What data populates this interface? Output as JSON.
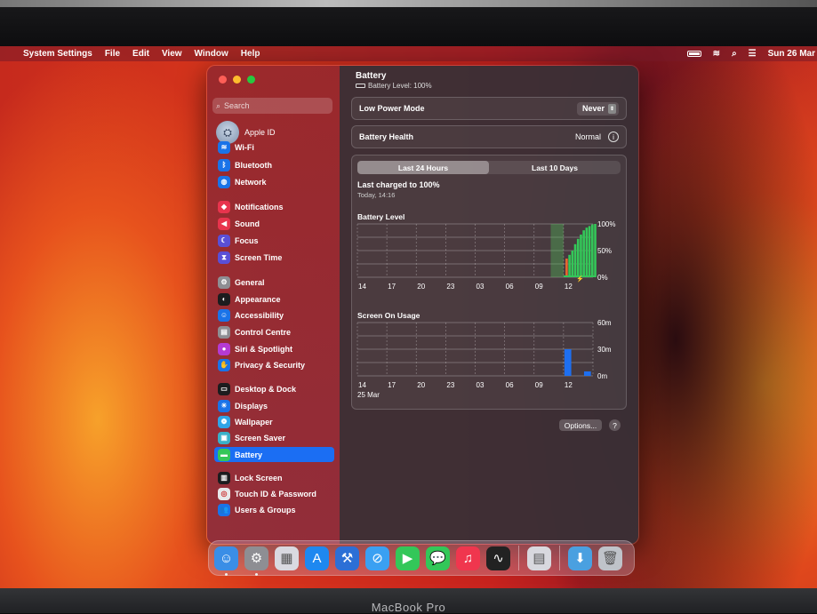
{
  "device_label": "MacBook Pro",
  "menubar": {
    "app": "System Settings",
    "items": [
      "File",
      "Edit",
      "View",
      "Window",
      "Help"
    ],
    "clock": "Sun 26 Mar"
  },
  "sidebar": {
    "search_placeholder": "Search",
    "apple_id": "Apple ID",
    "items": [
      {
        "label": "Wi-Fi",
        "icon": "wifi-icon",
        "color": "#1a73e8",
        "glyph": "≋"
      },
      {
        "label": "Bluetooth",
        "icon": "bluetooth-icon",
        "color": "#1a73e8",
        "glyph": "ᛒ"
      },
      {
        "label": "Network",
        "icon": "globe-icon",
        "color": "#1a73e8",
        "glyph": "◍"
      },
      {
        "label": "Notifications",
        "icon": "bell-icon",
        "color": "#e8344d",
        "glyph": "◆"
      },
      {
        "label": "Sound",
        "icon": "speaker-icon",
        "color": "#e8344d",
        "glyph": "◀"
      },
      {
        "label": "Focus",
        "icon": "moon-icon",
        "color": "#5a4fd6",
        "glyph": "☾"
      },
      {
        "label": "Screen Time",
        "icon": "hourglass-icon",
        "color": "#5a4fd6",
        "glyph": "⧗"
      },
      {
        "label": "General",
        "icon": "gear-icon",
        "color": "#8e8e93",
        "glyph": "⚙"
      },
      {
        "label": "Appearance",
        "icon": "appearance-icon",
        "color": "#1c1c1e",
        "glyph": "◐"
      },
      {
        "label": "Accessibility",
        "icon": "accessibility-icon",
        "color": "#1a73e8",
        "glyph": "☺"
      },
      {
        "label": "Control Centre",
        "icon": "control-centre-icon",
        "color": "#8e8e93",
        "glyph": "▤"
      },
      {
        "label": "Siri & Spotlight",
        "icon": "siri-icon",
        "color": "#b53ad3",
        "glyph": "●"
      },
      {
        "label": "Privacy & Security",
        "icon": "hand-icon",
        "color": "#1a73e8",
        "glyph": "✋"
      },
      {
        "label": "Desktop & Dock",
        "icon": "dock-icon",
        "color": "#1c1c1e",
        "glyph": "▭"
      },
      {
        "label": "Displays",
        "icon": "sun-icon",
        "color": "#1a73e8",
        "glyph": "☀"
      },
      {
        "label": "Wallpaper",
        "icon": "wallpaper-icon",
        "color": "#2fa4e7",
        "glyph": "❁"
      },
      {
        "label": "Screen Saver",
        "icon": "screensaver-icon",
        "color": "#3ab0c8",
        "glyph": "▣"
      },
      {
        "label": "Battery",
        "icon": "battery-icon",
        "color": "#34c759",
        "glyph": "▬"
      },
      {
        "label": "Lock Screen",
        "icon": "lock-icon",
        "color": "#1c1c1e",
        "glyph": "▥"
      },
      {
        "label": "Touch ID & Password",
        "icon": "fingerprint-icon",
        "color": "#e8e8ea",
        "glyph": "◎"
      },
      {
        "label": "Users & Groups",
        "icon": "users-icon",
        "color": "#1a73e8",
        "glyph": "👥"
      }
    ],
    "selected": "Battery"
  },
  "main": {
    "title": "Battery",
    "subtitle": "Battery Level: 100%",
    "low_power_label": "Low Power Mode",
    "low_power_value": "Never",
    "health_label": "Battery Health",
    "health_value": "Normal",
    "tabs": [
      "Last 24 Hours",
      "Last 10 Days"
    ],
    "active_tab": "Last 24 Hours",
    "last_charged": "Last charged to 100%",
    "last_charged_time": "Today, 14:16",
    "options_label": "Options...",
    "help_label": "?"
  },
  "chart_data": [
    {
      "type": "bar",
      "title": "Battery Level",
      "categories": [
        "14",
        "17",
        "20",
        "23",
        "03",
        "06",
        "09",
        "12"
      ],
      "y_tick_labels": [
        "100%",
        "50%",
        "0%"
      ],
      "ylim": [
        0,
        100
      ],
      "series": [
        {
          "name": "Battery Level",
          "x_hours_tail": [
            0,
            1,
            2,
            3,
            4,
            5,
            6,
            7,
            8,
            9,
            10
          ],
          "values": [
            35,
            42,
            50,
            62,
            72,
            80,
            88,
            93,
            96,
            99,
            100
          ]
        }
      ],
      "charging_indicator": true
    },
    {
      "type": "bar",
      "title": "Screen On Usage",
      "categories": [
        "14",
        "17",
        "20",
        "23",
        "03",
        "06",
        "09",
        "12"
      ],
      "y_tick_labels": [
        "60m",
        "30m",
        "0m"
      ],
      "ylim": [
        0,
        60
      ],
      "date_label": "25 Mar",
      "series": [
        {
          "name": "Screen On Usage",
          "bars": [
            {
              "at": "11",
              "value": 30
            },
            {
              "at": "13",
              "value": 5
            }
          ]
        }
      ]
    }
  ],
  "dock": [
    {
      "name": "finder-icon",
      "color": "#3a8ee6",
      "glyph": "☺"
    },
    {
      "name": "system-settings-icon",
      "color": "#8e8e93",
      "glyph": "⚙"
    },
    {
      "name": "launchpad-icon",
      "color": "#d9d9e0",
      "glyph": "▦"
    },
    {
      "name": "app-store-icon",
      "color": "#1e88f0",
      "glyph": "A"
    },
    {
      "name": "xcode-icon",
      "color": "#2c6fd6",
      "glyph": "⚒"
    },
    {
      "name": "safari-icon",
      "color": "#3aa0f2",
      "glyph": "⊘"
    },
    {
      "name": "facetime-icon",
      "color": "#33c759",
      "glyph": "▶"
    },
    {
      "name": "messages-icon",
      "color": "#33c759",
      "glyph": "💬"
    },
    {
      "name": "music-icon",
      "color": "#f0364e",
      "glyph": "♫"
    },
    {
      "name": "activity-monitor-icon",
      "color": "#222",
      "glyph": "∿"
    },
    {
      "name": "preview-icon",
      "color": "#d8d8de",
      "glyph": "▤"
    },
    {
      "name": "downloads-folder-icon",
      "color": "#4aa0e0",
      "glyph": "⬇"
    },
    {
      "name": "trash-icon",
      "color": "#bfc3c9",
      "glyph": "🗑"
    }
  ]
}
